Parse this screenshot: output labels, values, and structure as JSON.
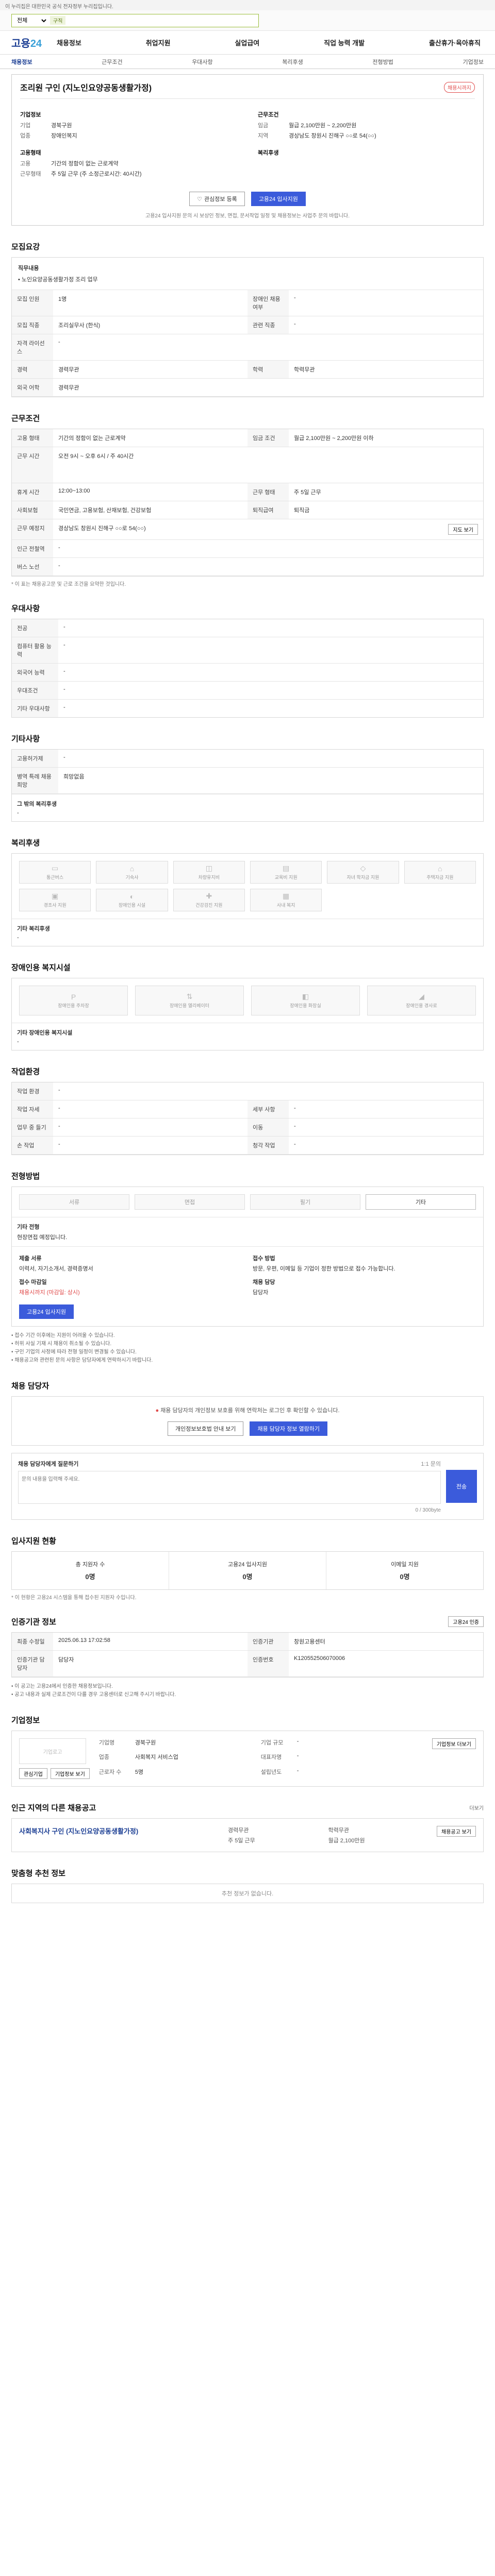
{
  "topbar": {
    "text": "이 누리집은 대한민국 공식 전자정부 누리집입니다."
  },
  "search": {
    "scope": "전체",
    "tag": "구직",
    "placeholder": ""
  },
  "header": {
    "logo_a": "고용",
    "logo_b": "24",
    "menu": [
      "채용정보",
      "취업지원",
      "실업급여",
      "직업 능력 개발",
      "출산휴가·육아휴직"
    ]
  },
  "tabs": [
    "채용정보",
    "근무조건",
    "우대사항",
    "복리후생",
    "전형방법",
    "기업정보"
  ],
  "job": {
    "title": "조리원 구인 (지노인요양공동생활가정)",
    "badge": "채용시까지",
    "company_h": "기업정보",
    "company_name_k": "기업",
    "company_name_v": "경북구원",
    "company_type_k": "업종",
    "company_type_v": "장애인복지",
    "cond_h": "근무조건",
    "wage_k": "임금",
    "wage_v": "월급 2,100만원 ~ 2,200만원",
    "loc_k": "지역",
    "loc_v": "경상남도 창원시 진해구 ○○로 54(○○)",
    "qual_h": "고용형태",
    "qual_rows": [
      {
        "k": "고용",
        "v": "기간의 정함이 없는 근로계약"
      },
      {
        "k": "근무형태",
        "v": "주 5일 근무 (주 소정근로시간: 40시간)"
      }
    ],
    "welfare_h": "복리후생"
  },
  "actions": {
    "save": "관심정보 등록",
    "apply": "고용24 입사지원",
    "notice": "고용24 입사지원 문의 시 보상인 정보, 면접, 문서작업 일정 및 채용정보는 사업주 문의 바랍니다."
  },
  "sec_recruit": {
    "h": "모집요강",
    "job_k": "직무내용",
    "job_v": "• 노인요양공동생활가정 조리 업무",
    "rows": [
      {
        "k1": "모집 인원",
        "v1": "1명",
        "k2": "장애인 채용 여부",
        "v2": "-"
      },
      {
        "k1": "모집 직종",
        "v1": "조리실무사 (한식)",
        "k2": "관련 직종",
        "v2": "-"
      },
      {
        "k1": "자격 라이선스",
        "v1": "-",
        "k2": "",
        "v2": ""
      },
      {
        "k1": "경력",
        "v1": "경력무관",
        "k2": "학력",
        "v2": "학력무관"
      },
      {
        "k1": "외국 어학",
        "v1": "경력무관",
        "k2": "",
        "v2": ""
      }
    ]
  },
  "sec_cond": {
    "h": "근무조건",
    "rows": [
      {
        "k1": "고용 형태",
        "v1": "기간의 정함이 없는 근로계약",
        "k2": "임금 조건",
        "v2": "월급 2,100만원 ~ 2,200만원 이하"
      },
      {
        "k1": "근무 시간",
        "v1": "오전 9시 ~ 오후 6시 / 주 40시간",
        "k2": "",
        "v2": ""
      },
      {
        "k1": "휴게 시간",
        "v1": "12:00~13:00",
        "k2": "근무 형태",
        "v2": "주 5일 근무"
      },
      {
        "k1": "사회보험",
        "v1": "국민연금, 고용보험, 산재보험, 건강보험",
        "k2": "퇴직급여",
        "v2": "퇴직금"
      },
      {
        "k1": "근무 예정지",
        "v1": "경상남도 창원시 진해구 ○○로 54(○○)",
        "k2": "",
        "v2": ""
      },
      {
        "k1": "인근 전철역",
        "v1": "-",
        "k2": "",
        "v2": ""
      },
      {
        "k1": "버스 노선",
        "v1": "-",
        "k2": "",
        "v2": ""
      }
    ],
    "map_btn": "지도 보기",
    "note": "* 이 표는 채용공고문 및 근로 조건을 요약한 것입니다."
  },
  "sec_pref": {
    "h": "우대사항",
    "rows": [
      {
        "k": "전공",
        "v": "-"
      },
      {
        "k": "컴퓨터 활용 능력",
        "v": "-"
      },
      {
        "k": "외국어 능력",
        "v": "-"
      },
      {
        "k": "우대조건",
        "v": "-"
      },
      {
        "k": "기타 우대사항",
        "v": "-"
      }
    ]
  },
  "sec_etc": {
    "h": "기타사항",
    "rows": [
      {
        "k": "고용허가제",
        "v": "-"
      },
      {
        "k": "병역 특례 채용 희망",
        "v": "희망없음"
      }
    ],
    "sub_k": "그 밖의 복리후생",
    "sub_v": "-"
  },
  "sec_welfare": {
    "h": "복리후생",
    "tiles": [
      "통근버스",
      "기숙사",
      "차량유지비",
      "교육비 지원",
      "자녀 학자금 지원",
      "주택자금 지원",
      "경조사 지원",
      "장애인용 시설",
      "건강검진 지원",
      "사내 복지"
    ],
    "etc_k": "기타 복리후생",
    "etc_v": "-"
  },
  "sec_disab": {
    "h": "장애인용 복지시설",
    "tiles": [
      "장애인용 주차장",
      "장애인용 엘리베이터",
      "장애인용 화장실",
      "장애인용 경사로"
    ],
    "etc_k": "기타 장애인용 복지시설",
    "etc_v": "-"
  },
  "sec_env": {
    "h": "작업환경",
    "rows": [
      {
        "k1": "작업 환경",
        "v1": "-",
        "k2": "",
        "v2": ""
      },
      {
        "k1": "작업 자세",
        "v1": "-",
        "k2": "세부 사항",
        "v2": "-"
      },
      {
        "k1": "업무 중 들기",
        "v1": "-",
        "k2": "이동",
        "v2": "-"
      },
      {
        "k1": "손 작업",
        "v1": "-",
        "k2": "청각 작업",
        "v2": "-"
      }
    ]
  },
  "sec_select": {
    "h": "전형방법",
    "steps": [
      "서류",
      "면접",
      "필기",
      "기타"
    ],
    "etc_k": "기타 전형",
    "etc_v": "현장면접 예정입니다.",
    "docs_k": "제출 서류",
    "docs_v": "이력서, 자기소개서, 경력증명서",
    "apply_k": "접수 마감일",
    "apply_v": "채용시까지 (마감일: 상시)",
    "method_k": "접수 방법",
    "method_v": "방문, 우편, 이메일 등 기업이 정한 방법으로 접수 가능합니다.",
    "contact_k": "채용 담당",
    "contact_v": "담당자",
    "apply_btn": "고용24 입사지원",
    "bullets": [
      "접수 기간 이후에는 지원이 어려울 수 있습니다.",
      "허위 사실 기재 시 채용이 취소될 수 있습니다.",
      "구인 기업의 사정에 따라 전형 일정이 변경될 수 있습니다.",
      "채용공고와 관련된 문의 사항은 담당자에게 연락하시기 바랍니다."
    ]
  },
  "sec_contact": {
    "h": "채용 담당자",
    "info": "채용 담당자의 개인정보 보호를 위해 연락처는 로그인 후 확인할 수 있습니다.",
    "btn1": "개인정보보호법 안내 보기",
    "btn2": "채용 담당자 정보 열람하기"
  },
  "sec_inquiry": {
    "h": "채용 담당자에게 질문하기",
    "sub": "1:1 문의",
    "placeholder": "문의 내용을 입력해 주세요.",
    "count": "0 / 300byte",
    "btn": "전송"
  },
  "sec_status": {
    "h": "입사지원 현황",
    "cells": [
      {
        "k": "총 지원자 수",
        "v": "0명"
      },
      {
        "k": "고용24 입사지원",
        "v": "0명"
      },
      {
        "k": "이메일 지원",
        "v": "0명"
      }
    ],
    "note": "* 이 현황은 고용24 시스템을 통해 접수된 지원자 수입니다."
  },
  "sec_info": {
    "h": "인증기관 정보",
    "btn": "고용24 인증",
    "rows": [
      {
        "k1": "최종 수정일",
        "v1": "2025.06.13 17:02:58",
        "k2": "인증기관",
        "v2": "창원고용센터"
      },
      {
        "k1": "인증기관 담당자",
        "v1": "담당자",
        "k2": "인증번호",
        "v2": "K120552506070006"
      }
    ],
    "bullets": [
      "이 공고는 고용24에서 인증한 채용정보입니다.",
      "공고 내용과 실제 근로조건이 다를 경우 고용센터로 신고해 주시기 바랍니다."
    ]
  },
  "sec_company": {
    "h": "기업정보",
    "logo": "기업로고",
    "btns": [
      "관심기업",
      "기업정보 보기"
    ],
    "rows": [
      {
        "k": "기업명",
        "v": "경북구원"
      },
      {
        "k": "업종",
        "v": "사회복지 서비스업"
      },
      {
        "k": "근로자 수",
        "v": "5명"
      },
      {
        "k": "기업 규모",
        "v": "-"
      },
      {
        "k": "대표자명",
        "v": "-"
      },
      {
        "k": "설립년도",
        "v": "-"
      }
    ],
    "detail_btn": "기업정보 더보기"
  },
  "sec_related": {
    "h": "인근 지역의 다른 채용공고",
    "more": "더보기",
    "title": "사회복지사 구인 (지노인요양공동생활가정)",
    "meta": [
      "경력무관",
      "학력무관",
      "주 5일 근무",
      "월급 2,100만원"
    ],
    "btn": "채용공고 보기"
  },
  "sec_recommend": {
    "h": "맞춤형 추천 정보",
    "empty": "추천 정보가 없습니다."
  }
}
